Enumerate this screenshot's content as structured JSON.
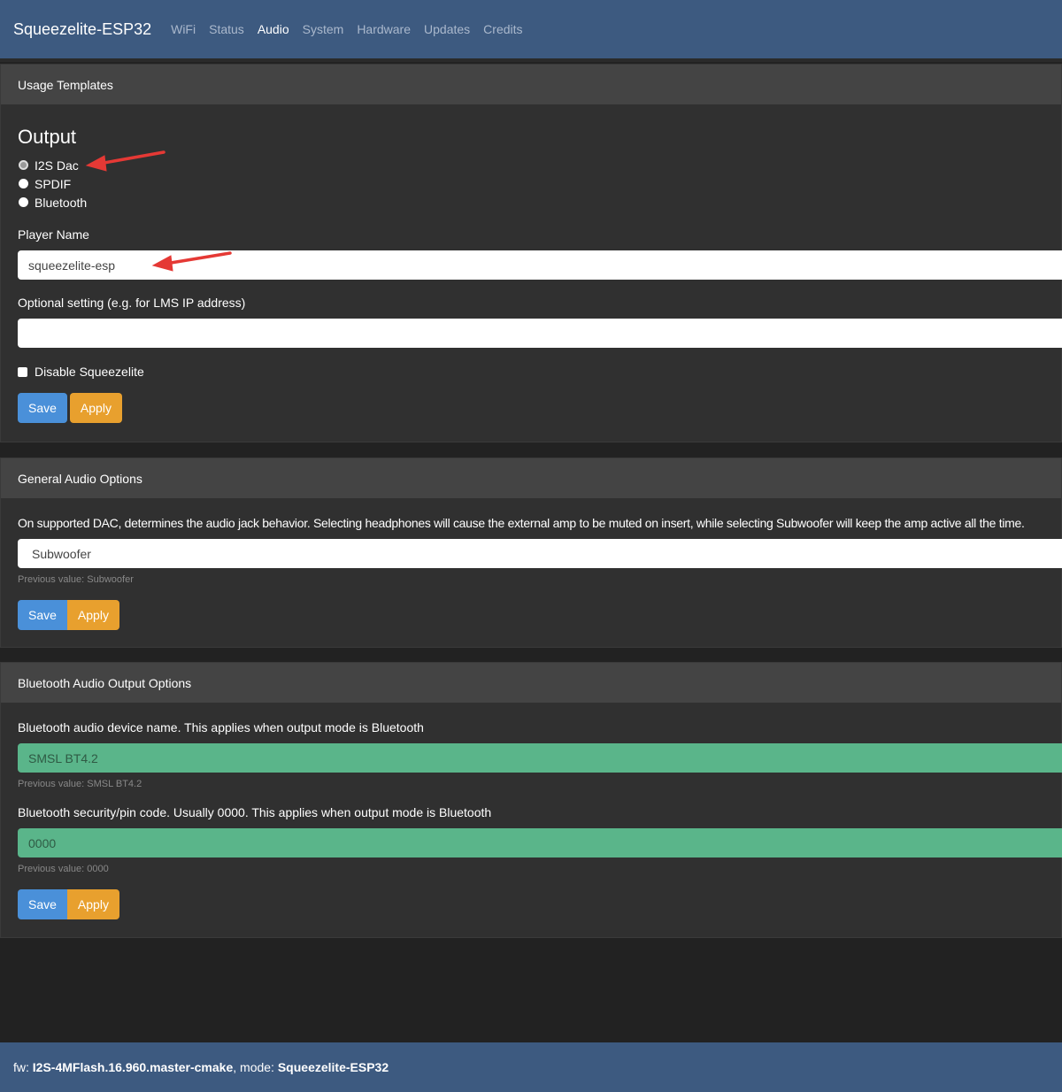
{
  "nav": {
    "brand": "Squeezelite-ESP32",
    "items": [
      "WiFi",
      "Status",
      "Audio",
      "System",
      "Hardware",
      "Updates",
      "Credits"
    ],
    "active": "Audio"
  },
  "usage": {
    "header": "Usage Templates",
    "output_title": "Output",
    "options": [
      "I2S Dac",
      "SPDIF",
      "Bluetooth"
    ],
    "selected": "I2S Dac",
    "player_label": "Player Name",
    "player_value": "squeezelite-esp",
    "optional_label": "Optional setting (e.g. for LMS IP address)",
    "optional_value": "",
    "disable_label": "Disable Squeezelite",
    "save": "Save",
    "apply": "Apply"
  },
  "general": {
    "header": "General Audio Options",
    "desc": "On supported DAC, determines the audio jack behavior. Selecting headphones will cause the external amp to be muted on insert, while selecting Subwoofer will keep the amp active all the time.",
    "value": "Subwoofer",
    "prev": "Previous value: Subwoofer",
    "save": "Save",
    "apply": "Apply"
  },
  "bt": {
    "header": "Bluetooth Audio Output Options",
    "name_label": "Bluetooth audio device name. This applies when output mode is Bluetooth",
    "name_value": "SMSL BT4.2",
    "name_prev": "Previous value: SMSL BT4.2",
    "pin_label": "Bluetooth security/pin code. Usually 0000. This applies when output mode is Bluetooth",
    "pin_value": "0000",
    "pin_prev": "Previous value: 0000",
    "save": "Save",
    "apply": "Apply"
  },
  "footer": {
    "fw_label": "fw: ",
    "fw": "I2S-4MFlash.16.960.master-cmake",
    "mode_label": ", mode: ",
    "mode": "Squeezelite-ESP32"
  },
  "colors": {
    "navbar": "#3d5a80",
    "save": "#4a90d9",
    "apply": "#e8a02e",
    "valid_input": "#5ab58a",
    "annotation_arrow": "#e53935"
  }
}
